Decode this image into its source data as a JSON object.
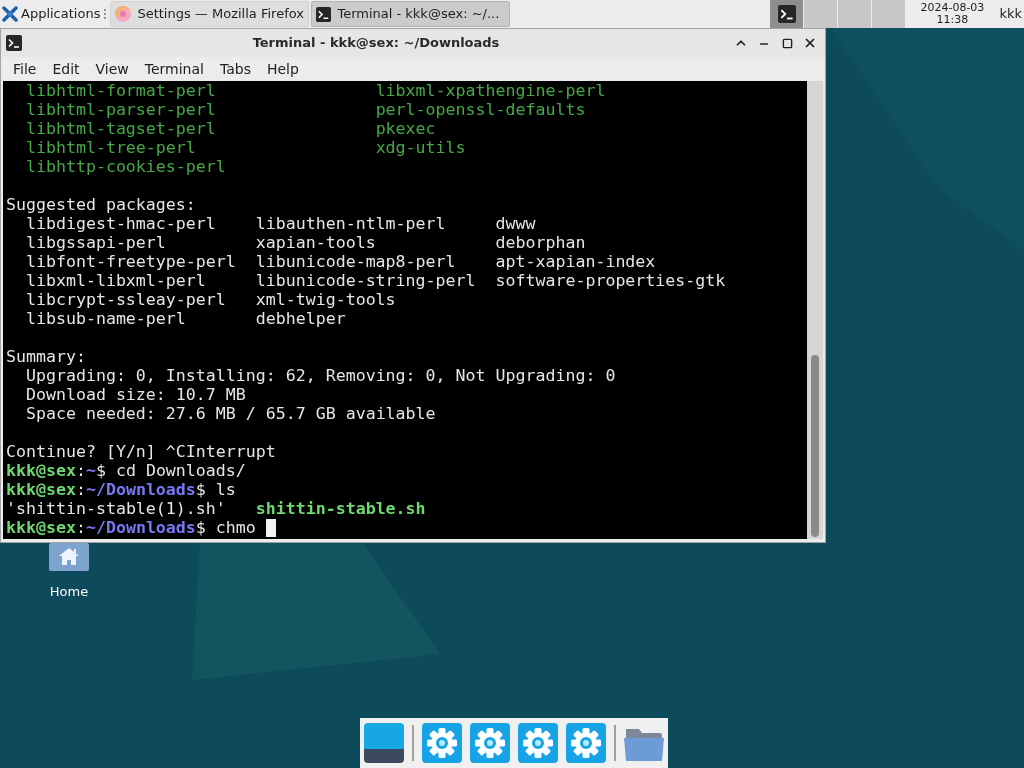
{
  "top_panel": {
    "applications_label": "Applications",
    "tasks": [
      {
        "kind": "browser",
        "title": "Settings — Mozilla Firefox",
        "selected": false
      },
      {
        "kind": "terminal",
        "title": "Terminal - kkk@sex: ~/...",
        "selected": true
      }
    ],
    "workspaces": [
      {
        "selected": true,
        "kind": "terminal"
      },
      {
        "selected": false,
        "kind": "empty"
      },
      {
        "selected": false,
        "kind": "empty"
      },
      {
        "selected": false,
        "kind": "empty"
      }
    ],
    "clock": {
      "date": "2024-08-03",
      "time": "11:38"
    },
    "user": "kkk"
  },
  "window": {
    "title": "Terminal - kkk@sex: ~/Downloads",
    "menu": [
      "File",
      "Edit",
      "View",
      "Terminal",
      "Tabs",
      "Help"
    ]
  },
  "terminal": {
    "new_packages": [
      [
        "libhtml-format-perl",
        "libxml-xpathengine-perl"
      ],
      [
        "libhtml-parser-perl",
        "perl-openssl-defaults"
      ],
      [
        "libhtml-tagset-perl",
        "pkexec"
      ],
      [
        "libhtml-tree-perl",
        "xdg-utils"
      ],
      [
        "libhttp-cookies-perl"
      ]
    ],
    "suggested_heading": "Suggested packages:",
    "suggested_packages": [
      [
        "libdigest-hmac-perl",
        "libauthen-ntlm-perl",
        "dwww"
      ],
      [
        "libgssapi-perl",
        "xapian-tools",
        "deborphan"
      ],
      [
        "libfont-freetype-perl",
        "libunicode-map8-perl",
        "apt-xapian-index"
      ],
      [
        "libxml-libxml-perl",
        "libunicode-string-perl",
        "software-properties-gtk"
      ],
      [
        "libcrypt-ssleay-perl",
        "xml-twig-tools"
      ],
      [
        "libsub-name-perl",
        "debhelper"
      ]
    ],
    "summary_heading": "Summary:",
    "summary": [
      "Upgrading: 0, Installing: 62, Removing: 0, Not Upgrading: 0",
      "Download size: 10.7 MB",
      "Space needed: 27.6 MB / 65.7 GB available"
    ],
    "continue_line": "Continue? [Y/n] ^CInterrupt",
    "session": [
      {
        "kind": "prompt",
        "segments": [
          {
            "text": "kkk@sex",
            "kind": "user"
          },
          {
            "text": ":",
            "kind": "plain"
          },
          {
            "text": "~",
            "kind": "path"
          },
          {
            "text": "$ cd Downloads/",
            "kind": "plain"
          }
        ]
      },
      {
        "kind": "prompt",
        "segments": [
          {
            "text": "kkk@sex",
            "kind": "user"
          },
          {
            "text": ":",
            "kind": "plain"
          },
          {
            "text": "~/Downloads",
            "kind": "path"
          },
          {
            "text": "$ ls",
            "kind": "plain"
          }
        ]
      },
      {
        "kind": "listing",
        "files": [
          {
            "name": "'shittin-stable(1).sh'",
            "kind": "plain"
          },
          {
            "name": "shittin-stable.sh",
            "kind": "executable"
          }
        ]
      },
      {
        "kind": "prompt",
        "cursor": true,
        "segments": [
          {
            "text": "kkk@sex",
            "kind": "user"
          },
          {
            "text": ":",
            "kind": "plain"
          },
          {
            "text": "~/Downloads",
            "kind": "path"
          },
          {
            "text": "$ chmo",
            "kind": "plain"
          }
        ]
      }
    ]
  },
  "desktop_icons": [
    {
      "label": "Home"
    }
  ],
  "dock": {
    "items": [
      {
        "kind": "desktop"
      },
      {
        "kind": "separator"
      },
      {
        "kind": "settings"
      },
      {
        "kind": "settings"
      },
      {
        "kind": "settings"
      },
      {
        "kind": "settings"
      },
      {
        "kind": "separator"
      },
      {
        "kind": "folder"
      }
    ]
  }
}
